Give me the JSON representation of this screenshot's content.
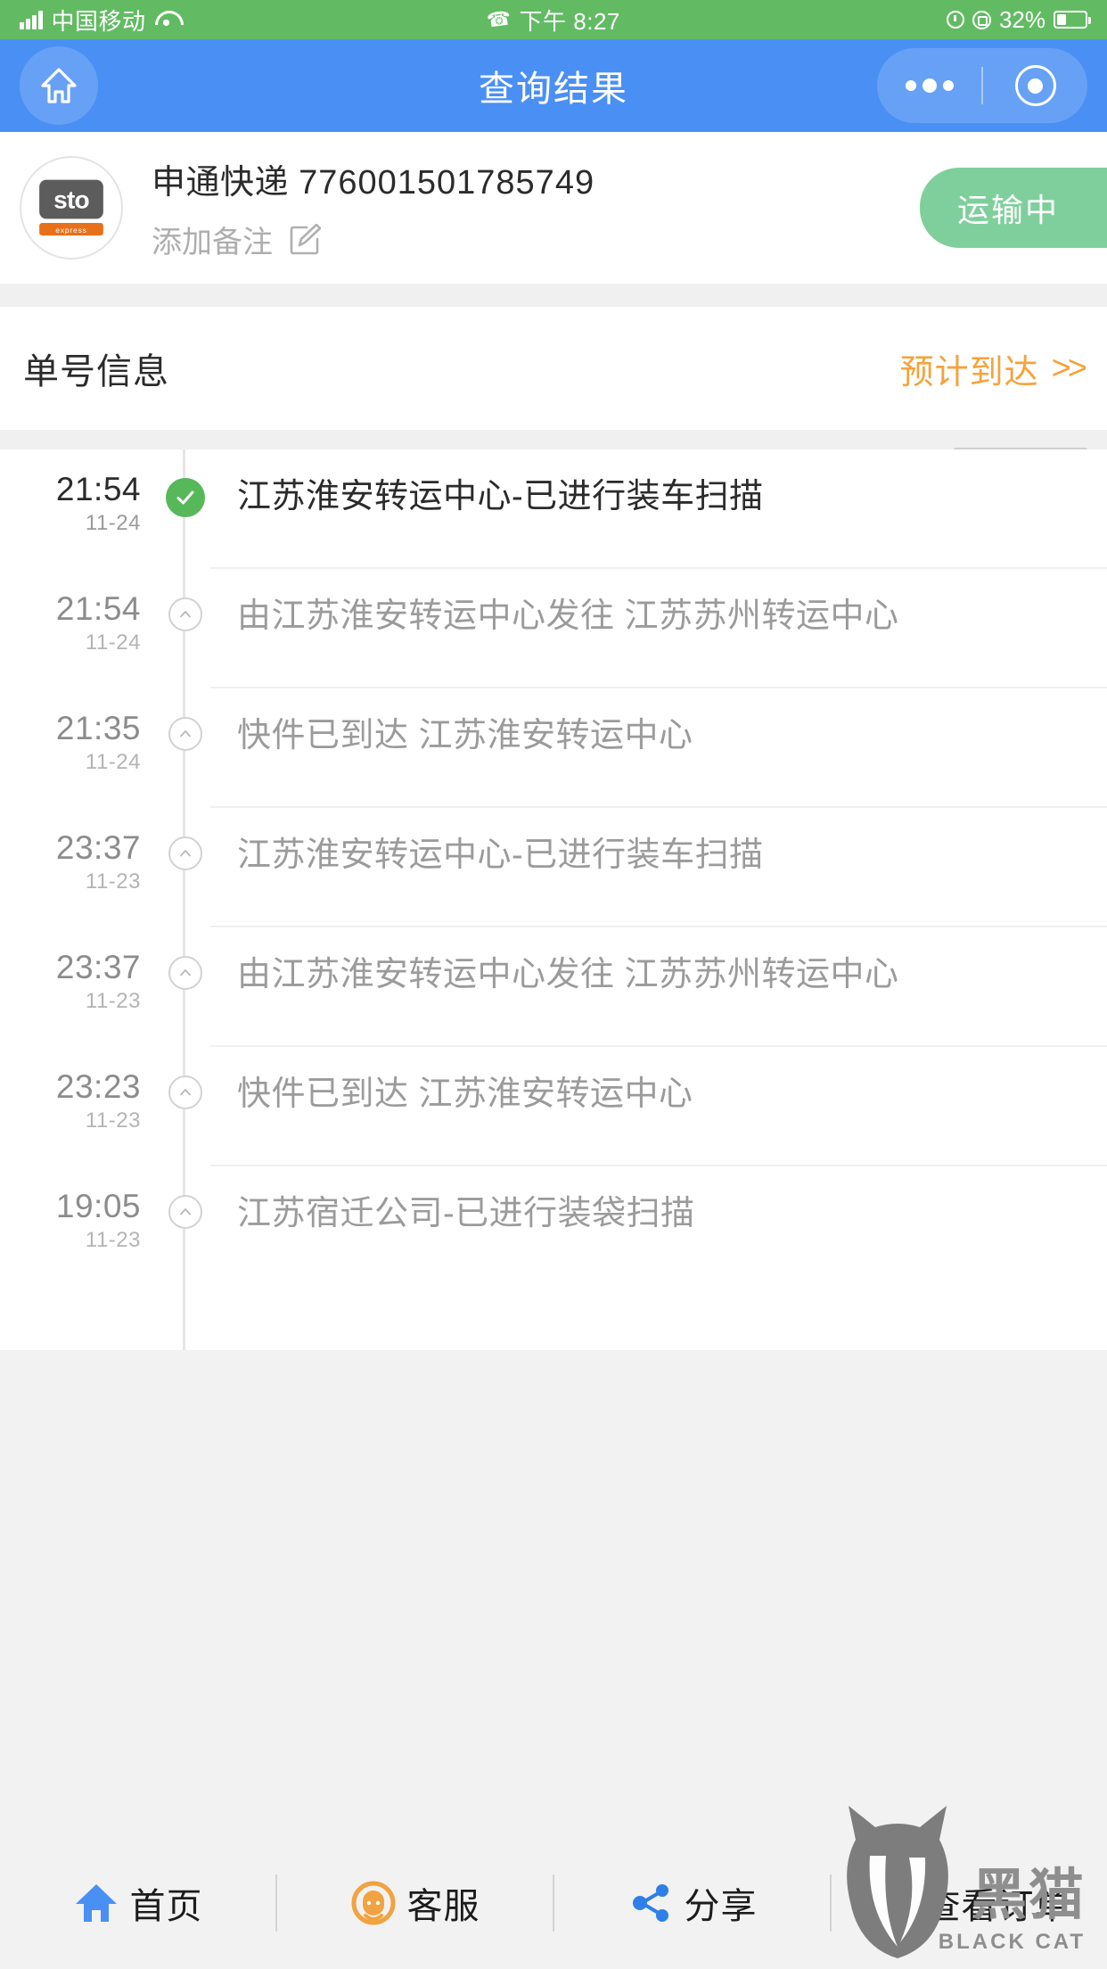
{
  "statusbar": {
    "carrier": "中国移动",
    "time": "下午 8:27",
    "battery_percent": "32%",
    "signal_icon": "signal-bars-icon",
    "wifi_icon": "wifi-icon",
    "phone_icon": "phone-call-icon",
    "alarm_icon": "alarm-clock-icon",
    "rotation_icon": "screen-rotation-icon",
    "battery_icon": "battery-icon",
    "background_color": "#62bb63"
  },
  "navbar": {
    "title": "查询结果",
    "home_icon": "home-icon",
    "more_icon": "more-dots-icon",
    "target_icon": "target-circle-icon",
    "background_color": "#4a90f4"
  },
  "courier": {
    "logo_text": "sto",
    "logo_sub": "express",
    "name": "申通快递",
    "tracking_number": "776001501785749",
    "note_label": "添加备注",
    "note_icon": "edit-note-icon",
    "status_label": "运输中",
    "status_color": "#7fcf9c"
  },
  "section": {
    "title": "单号信息",
    "link_label": "预计到达",
    "link_chevron": "»",
    "link_color": "#f5a33c"
  },
  "timeline": {
    "items": [
      {
        "time": "21:54",
        "date": "11-24",
        "text": "江苏淮安转运中心-已进行装车扫描",
        "marker": "check-circle-icon",
        "current": true
      },
      {
        "time": "21:54",
        "date": "11-24",
        "text": "由江苏淮安转运中心发往 江苏苏州转运中心",
        "marker": "chevron-up-circle-icon",
        "current": false
      },
      {
        "time": "21:35",
        "date": "11-24",
        "text": "快件已到达 江苏淮安转运中心",
        "marker": "chevron-up-circle-icon",
        "current": false
      },
      {
        "time": "23:37",
        "date": "11-23",
        "text": "江苏淮安转运中心-已进行装车扫描",
        "marker": "chevron-up-circle-icon",
        "current": false
      },
      {
        "time": "23:37",
        "date": "11-23",
        "text": "由江苏淮安转运中心发往 江苏苏州转运中心",
        "marker": "chevron-up-circle-icon",
        "current": false
      },
      {
        "time": "23:23",
        "date": "11-23",
        "text": "快件已到达 江苏淮安转运中心",
        "marker": "chevron-up-circle-icon",
        "current": false
      },
      {
        "time": "19:05",
        "date": "11-23",
        "text": "江苏宿迁公司-已进行装袋扫描",
        "marker": "chevron-up-circle-icon",
        "current": false
      }
    ]
  },
  "bottombar": {
    "items": [
      {
        "label": "首页",
        "icon": "home-filled-icon",
        "color": "#4a90f4"
      },
      {
        "label": "客服",
        "icon": "customer-service-icon",
        "color": "#f0a340"
      },
      {
        "label": "分享",
        "icon": "share-nodes-icon",
        "color": "#2f7fe8"
      },
      {
        "label": "查看订单",
        "icon": "order-list-icon",
        "color": "#d96a6a"
      }
    ]
  },
  "watermark": {
    "title": "黑猫",
    "subtitle": "BLACK CAT"
  }
}
